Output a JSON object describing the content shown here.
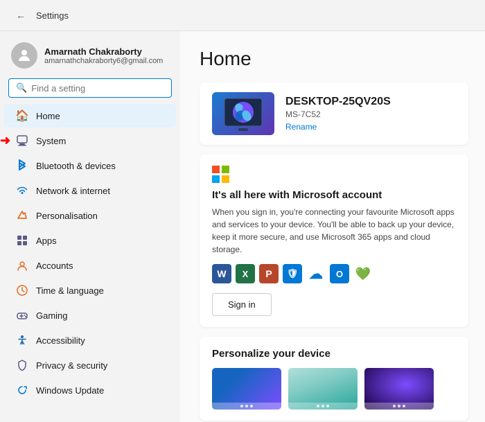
{
  "titlebar": {
    "title": "Settings",
    "back_label": "←"
  },
  "sidebar": {
    "search_placeholder": "Find a setting",
    "profile": {
      "name": "Amarnath Chakraborty",
      "email": "amarnathchakraborty6@gmail.com"
    },
    "nav_items": [
      {
        "id": "home",
        "label": "Home",
        "active": true
      },
      {
        "id": "system",
        "label": "System",
        "active": false,
        "has_arrow": true
      },
      {
        "id": "bluetooth",
        "label": "Bluetooth & devices",
        "active": false
      },
      {
        "id": "network",
        "label": "Network & internet",
        "active": false
      },
      {
        "id": "personalisation",
        "label": "Personalisation",
        "active": false
      },
      {
        "id": "apps",
        "label": "Apps",
        "active": false
      },
      {
        "id": "accounts",
        "label": "Accounts",
        "active": false
      },
      {
        "id": "time",
        "label": "Time & language",
        "active": false
      },
      {
        "id": "gaming",
        "label": "Gaming",
        "active": false
      },
      {
        "id": "accessibility",
        "label": "Accessibility",
        "active": false
      },
      {
        "id": "privacy",
        "label": "Privacy & security",
        "active": false
      },
      {
        "id": "update",
        "label": "Windows Update",
        "active": false
      }
    ]
  },
  "main": {
    "page_title": "Home",
    "device": {
      "name": "DESKTOP-25QV20S",
      "model": "MS-7C52",
      "rename_label": "Rename"
    },
    "ms_card": {
      "title": "It's all here with Microsoft account",
      "description": "When you sign in, you're connecting your favourite Microsoft apps and services to your device. You'll be able to back up your device, keep it more secure, and use Microsoft 365 apps and cloud storage.",
      "sign_in_label": "Sign in"
    },
    "personalize_card": {
      "title": "Personalize your device"
    }
  }
}
